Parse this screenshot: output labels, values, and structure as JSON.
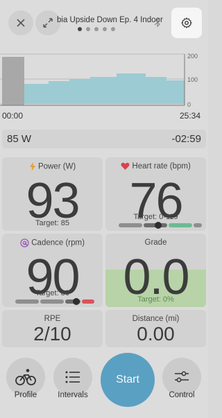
{
  "header": {
    "title": "bia Upside Down Ep. 4 Indoor",
    "page_dots": 5,
    "active_dot": 0
  },
  "chart": {
    "y_max_label": "200",
    "y_mid_label": "100",
    "y_min_label": "0",
    "time_start": "00:00",
    "time_end": "25:34",
    "fill_color": "#9ccbd3",
    "elapsed_color": "#a8a8a8"
  },
  "strip": {
    "power": "85 W",
    "remaining": "-02:59"
  },
  "tiles": {
    "power": {
      "label": "Power (W)",
      "value": "93",
      "target": "Target: 85",
      "icon_color": "#e0a02c"
    },
    "heart_rate": {
      "label": "Heart rate (bpm)",
      "value": "76",
      "target": "Target: 0-119",
      "icon_color": "#d9434a"
    },
    "cadence": {
      "label": "Cadence (rpm)",
      "value": "90",
      "target": "Target: 80",
      "icon_color": "#9b59b6"
    },
    "grade": {
      "label": "Grade",
      "value": "0.0",
      "target": "Target: 0%"
    },
    "rpe": {
      "label": "RPE",
      "value": "2/10"
    },
    "distance": {
      "label": "Distance (mi)",
      "value": "0.00"
    }
  },
  "nav": {
    "profile": "Profile",
    "intervals": "Intervals",
    "start": "Start",
    "control": "Control"
  }
}
